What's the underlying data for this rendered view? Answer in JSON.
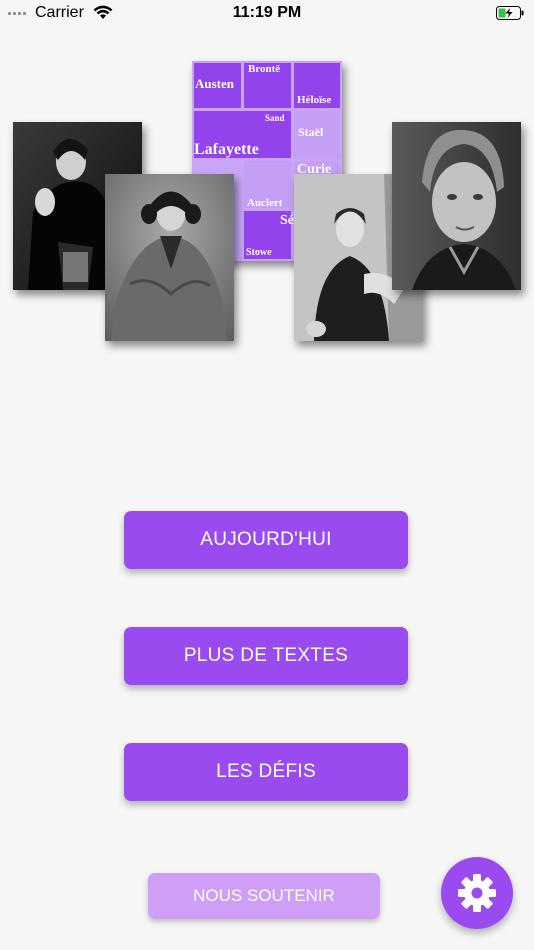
{
  "status_bar": {
    "carrier": "Carrier",
    "time": "11:19 PM",
    "signal_icon": "signal-dots-icon",
    "wifi_icon": "wifi-icon",
    "battery_icon": "battery-charging-icon"
  },
  "hero": {
    "word_cloud": [
      "Austen",
      "Brontë",
      "Héloïse",
      "Sand",
      "Staël",
      "Lafayette",
      "Curie",
      "Auclert",
      "Sé",
      "s",
      "Stowe"
    ]
  },
  "buttons": {
    "today": "AUJOURD'HUI",
    "more_texts": "PLUS DE TEXTES",
    "challenges": "LES DÉFIS",
    "support": "NOUS SOUTENIR"
  },
  "settings_icon": "gear-icon",
  "colors": {
    "accent": "#9a4bf0",
    "accent_light": "#cf9ff8",
    "background": "#f6f6f6"
  }
}
